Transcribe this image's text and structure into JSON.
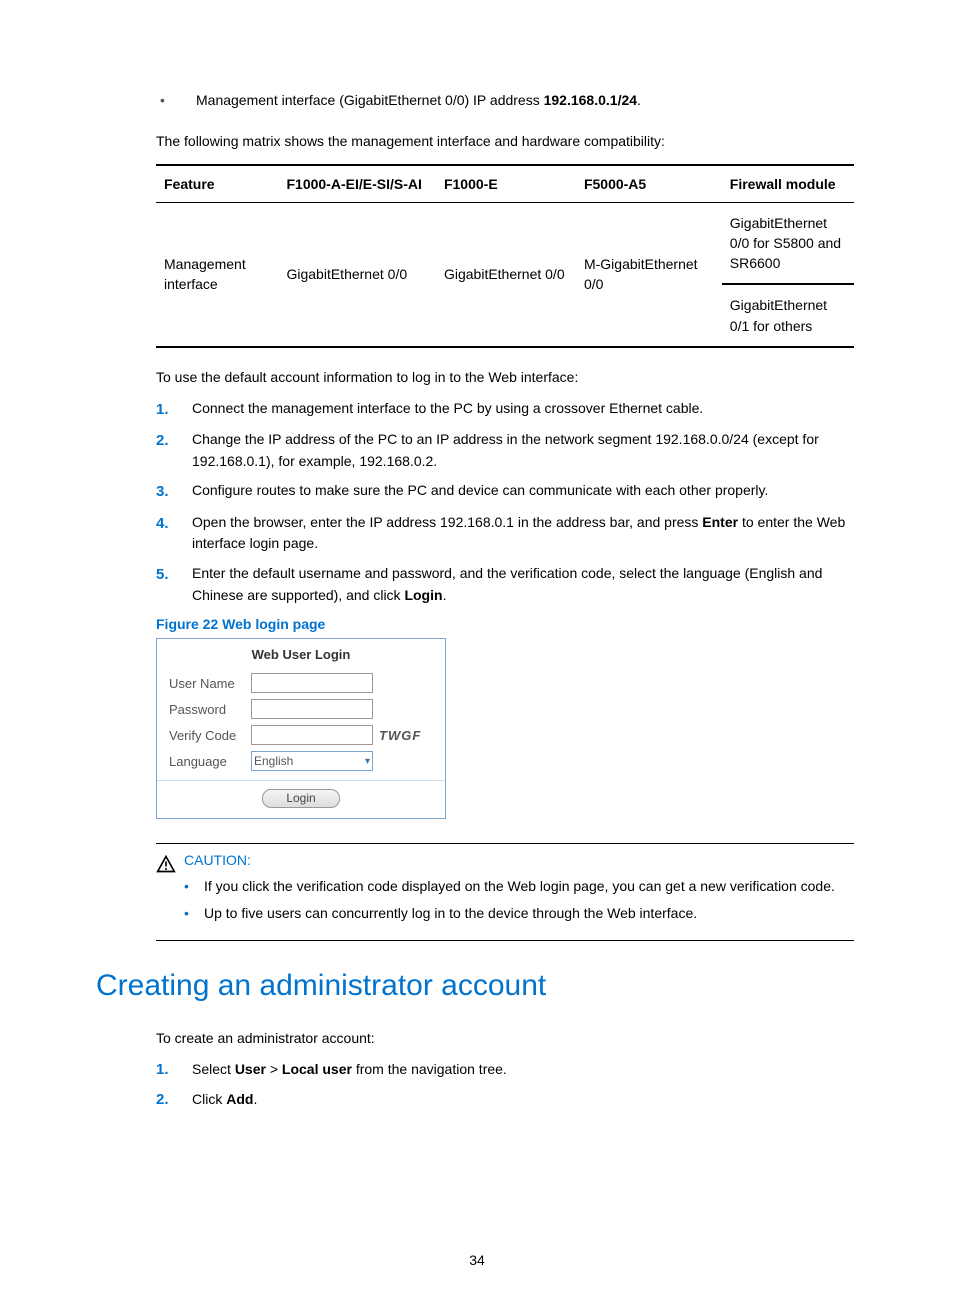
{
  "top_bullet": {
    "prefix": "Management interface (GigabitEthernet 0/0) IP address ",
    "value": "192.168.0.1/24",
    "suffix": "."
  },
  "matrix_intro": "The following matrix shows the management interface and hardware compatibility:",
  "matrix": {
    "headers": [
      "Feature",
      "F1000-A-EI/E-SI/S-AI",
      "F1000-E",
      "F5000-A5",
      "Firewall module"
    ],
    "row_label": "Management interface",
    "cells": {
      "c1": "GigabitEthernet 0/0",
      "c2": "GigabitEthernet 0/0",
      "c3": "M-GigabitEthernet 0/0",
      "c4a": "GigabitEthernet 0/0 for S5800 and SR6600",
      "c4b": "GigabitEthernet 0/1 for others"
    }
  },
  "use_default_intro": "To use the default account information to log in to the Web interface:",
  "steps": [
    "Connect the management interface to the PC by using a crossover Ethernet cable.",
    "Change the IP address of the PC to an IP address in the network segment 192.168.0.0/24 (except for 192.168.0.1), for example, 192.168.0.2.",
    "Configure routes to make sure the PC and device can communicate with each other properly."
  ],
  "step4": {
    "pre": "Open the browser, enter the IP address 192.168.0.1 in the address bar, and press ",
    "bold": "Enter",
    "post": " to enter the Web interface login page."
  },
  "step5": {
    "pre": "Enter the default username and password, and the verification code, select the language (English and Chinese are supported), and click ",
    "bold": "Login",
    "post": "."
  },
  "figure_caption": "Figure 22 Web login page",
  "login": {
    "title": "Web User Login",
    "username_label": "User Name",
    "password_label": "Password",
    "verify_label": "Verify Code",
    "verify_code": "TWGF",
    "language_label": "Language",
    "language_value": "English",
    "button": "Login"
  },
  "caution": {
    "label": "CAUTION:",
    "items": [
      "If you click the verification code displayed on the Web login page, you can get a new verification code.",
      "Up to five users can concurrently log in to the device through the Web interface."
    ]
  },
  "h1": "Creating an administrator account",
  "admin_intro": "To create an administrator account:",
  "admin_step1": {
    "pre": "Select ",
    "b1": "User",
    "mid": " > ",
    "b2": "Local user",
    "post": " from the navigation tree."
  },
  "admin_step2": {
    "pre": "Click ",
    "b1": "Add",
    "post": "."
  },
  "page_number": "34"
}
